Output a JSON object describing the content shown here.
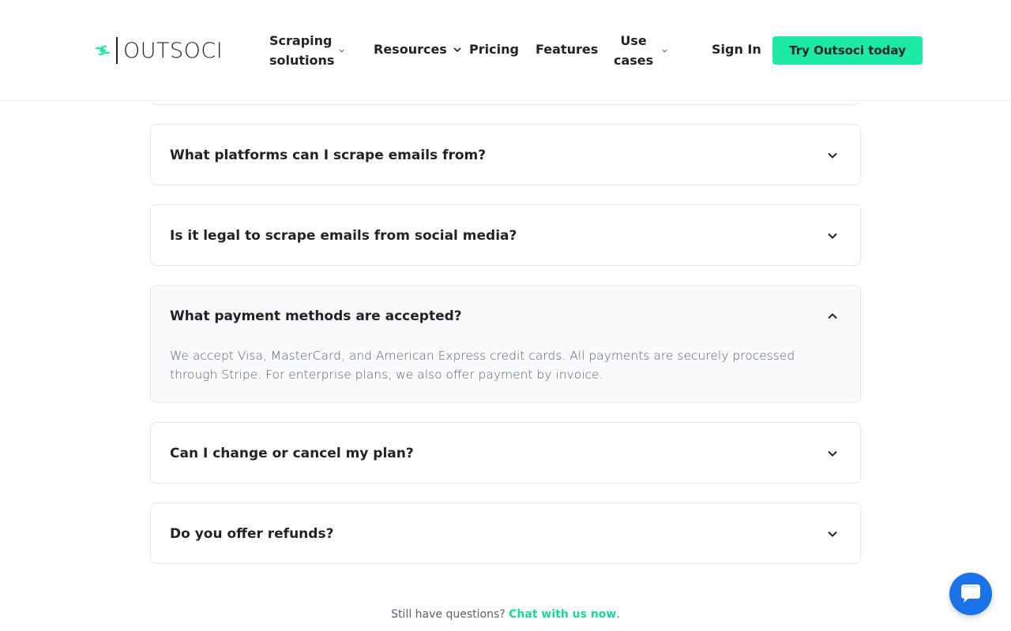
{
  "brand": {
    "name": "OUTSOCI",
    "accent": "#1de9a6"
  },
  "nav": {
    "scraping_solutions": "Scraping solutions",
    "resources": "Resources",
    "pricing": "Pricing",
    "features": "Features",
    "use_cases": "Use cases",
    "sign_in": "Sign In",
    "cta": "Try Outsoci today"
  },
  "faq": [
    {
      "question": "What platforms can I scrape emails from?",
      "expanded": false
    },
    {
      "question": "Is it legal to scrape emails from social media?",
      "expanded": false
    },
    {
      "question": "What payment methods are accepted?",
      "expanded": true,
      "answer": "We accept Visa, MasterCard, and American Express credit cards. All payments are securely processed through Stripe. For enterprise plans, we also offer payment by invoice."
    },
    {
      "question": "Can I change or cancel my plan?",
      "expanded": false
    },
    {
      "question": "Do you offer refunds?",
      "expanded": false
    }
  ],
  "footer": {
    "prefix": "Still have questions?",
    "link": "Chat with us now",
    "suffix": "."
  },
  "icons": {
    "logo": "link-icon",
    "chevron": "chevron-down-icon",
    "chat": "chat-icon"
  }
}
